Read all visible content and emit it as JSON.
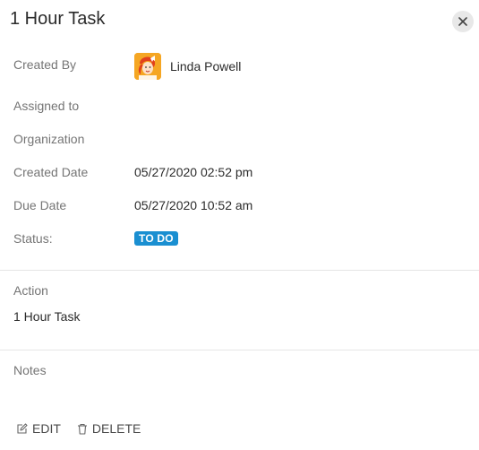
{
  "panel": {
    "title": "1 Hour Task",
    "close_icon": "close-icon"
  },
  "details": {
    "created_by_label": "Created By",
    "created_by_name": "Linda Powell",
    "assigned_to_label": "Assigned to",
    "organization_label": "Organization",
    "created_date_label": "Created Date",
    "created_date_value": "05/27/2020 02:52 pm",
    "due_date_label": "Due Date",
    "due_date_value": "05/27/2020 10:52 am",
    "status_label": "Status:",
    "status_value": "TO DO"
  },
  "action_section": {
    "label": "Action",
    "value": "1 Hour Task"
  },
  "notes_section": {
    "label": "Notes"
  },
  "footer": {
    "edit_label": "EDIT",
    "edit_icon": "edit-icon",
    "delete_label": "DELETE",
    "delete_icon": "trash-icon"
  },
  "colors": {
    "status_badge": "#1a8fd1",
    "label_text": "#757575",
    "value_text": "#2b2b2b"
  }
}
